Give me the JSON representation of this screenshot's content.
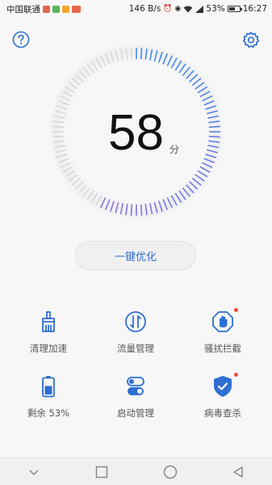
{
  "status_bar": {
    "carrier": "中国联通",
    "net_speed": "146 B/s",
    "battery_pct": "53%",
    "time": "16:27"
  },
  "header": {
    "help_icon": "question-circle-icon",
    "settings_icon": "gear-icon"
  },
  "score": {
    "value": "58",
    "unit": "分",
    "progress": 0.58
  },
  "optimize_button": {
    "label": "一键优化"
  },
  "tools": [
    {
      "label": "清理加速",
      "icon": "broom-icon",
      "badge": false
    },
    {
      "label": "流量管理",
      "icon": "data-traffic-icon",
      "badge": false
    },
    {
      "label": "骚扰拦截",
      "icon": "hand-block-icon",
      "badge": true
    },
    {
      "label": "剩余 53%",
      "icon": "battery-icon",
      "badge": false
    },
    {
      "label": "启动管理",
      "icon": "startup-toggle-icon",
      "badge": false
    },
    {
      "label": "病毒查杀",
      "icon": "shield-check-icon",
      "badge": true
    }
  ],
  "colors": {
    "accent": "#2e6fd1",
    "gauge_start": "#8d6fe0",
    "gauge_end": "#3d8eea",
    "gauge_track": "#d8d8d8",
    "badge": "#f24a3c"
  }
}
